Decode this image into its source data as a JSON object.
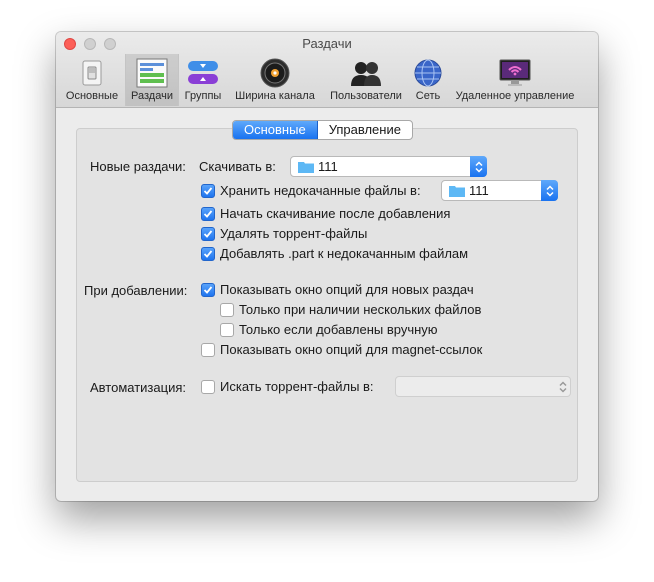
{
  "window": {
    "title": "Раздачи"
  },
  "toolbar": {
    "items": [
      {
        "label": "Основные",
        "icon": "light-switch-icon"
      },
      {
        "label": "Раздачи",
        "icon": "transfers-list-icon"
      },
      {
        "label": "Группы",
        "icon": "groups-icon"
      },
      {
        "label": "Ширина канала",
        "icon": "speed-dial-icon"
      },
      {
        "label": "Пользователи",
        "icon": "users-icon"
      },
      {
        "label": "Сеть",
        "icon": "globe-icon"
      },
      {
        "label": "Удаленное управление",
        "icon": "remote-monitor-icon"
      }
    ],
    "selected_index": 1
  },
  "tabs": {
    "basic": "Основные",
    "management": "Управление",
    "active": "basic"
  },
  "new_transfers": {
    "section_label": "Новые раздачи:",
    "download_to_label": "Скачивать в:",
    "download_to_value": "111",
    "keep_incomplete": {
      "label": "Хранить недокачанные файлы в:",
      "checked": true,
      "folder": "111"
    },
    "start_after_add": {
      "label": "Начать скачивание после добавления",
      "checked": true
    },
    "delete_torrents": {
      "label": "Удалять торрент-файлы",
      "checked": true
    },
    "append_part": {
      "label": "Добавлять .part к недокачанным файлам",
      "checked": true
    }
  },
  "on_add": {
    "section_label": "При добавлении:",
    "show_options": {
      "label": "Показывать окно опций для новых раздач",
      "checked": true
    },
    "only_multiple": {
      "label": "Только при наличии нескольких файлов",
      "checked": false
    },
    "only_manual": {
      "label": "Только если добавлены вручную",
      "checked": false
    },
    "show_magnet": {
      "label": "Показывать окно опций для magnet-ссылок",
      "checked": false
    }
  },
  "automation": {
    "section_label": "Автоматизация:",
    "watch_folder": {
      "label": "Искать торрент-файлы в:",
      "checked": false,
      "value": ""
    }
  },
  "colors": {
    "accent": "#1f74ef",
    "close": "#fc5f57"
  }
}
